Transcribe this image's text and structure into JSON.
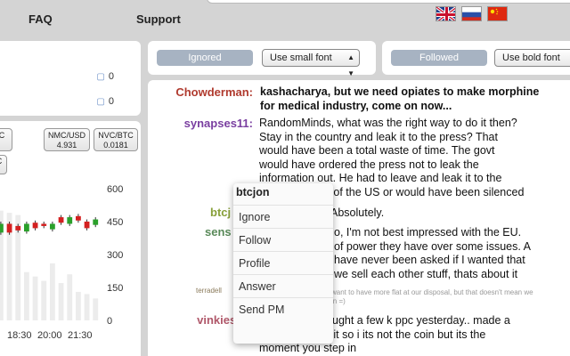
{
  "nav": {
    "faq": "FAQ",
    "support": "Support"
  },
  "languages": [
    "English",
    "Russian",
    "Chinese"
  ],
  "left_top": {
    "counts": [
      "0",
      "0"
    ]
  },
  "ticker": {
    "boxes": [
      {
        "pair": "C",
        "value": ""
      },
      {
        "pair": "NMC/USD",
        "value": "4.931"
      },
      {
        "pair": "NVC/BTC",
        "value": "0.0181"
      },
      {
        "pair": "C",
        "value": ""
      }
    ]
  },
  "chart_data": {
    "type": "candlestick",
    "x_ticks": [
      "18:30",
      "20:00",
      "21:30"
    ],
    "y_ticks": [
      "600",
      "450",
      "300",
      "150",
      "0"
    ],
    "ylim": [
      0,
      600
    ],
    "candles": [
      {
        "open": 400,
        "close": 440,
        "color": "#2aa02a"
      },
      {
        "open": 440,
        "close": 400,
        "color": "#d42020"
      },
      {
        "open": 430,
        "close": 410,
        "color": "#d42020"
      },
      {
        "open": 440,
        "close": 405,
        "color": "#2aa02a"
      },
      {
        "open": 445,
        "close": 420,
        "color": "#d42020"
      },
      {
        "open": 430,
        "close": 440,
        "color": "#d42020"
      },
      {
        "open": 440,
        "close": 415,
        "color": "#2aa02a"
      },
      {
        "open": 445,
        "close": 470,
        "color": "#d42020"
      },
      {
        "open": 470,
        "close": 440,
        "color": "#2aa02a"
      },
      {
        "open": 455,
        "close": 475,
        "color": "#d42020"
      },
      {
        "open": 450,
        "close": 420,
        "color": "#d42020"
      },
      {
        "open": 435,
        "close": 460,
        "color": "#2aa02a"
      }
    ],
    "volume": [
      500,
      490,
      480,
      220,
      200,
      180,
      260,
      170,
      210,
      130,
      120,
      100
    ]
  },
  "controls": {
    "ignored_label": "Ignored",
    "small_font_option": "Use small font",
    "followed_label": "Followed",
    "bold_font_option": "Use bold font"
  },
  "messages": [
    {
      "user": "Chowderman:",
      "color": "#b03a2e",
      "lines": [
        "kashacharya, but we need opiates to make morphine",
        "for medical industry, come on now..."
      ],
      "bold": true
    },
    {
      "user": "synapses11:",
      "color": "#7a3fa0",
      "lines": [
        "RandomMinds, what was the right way to do it then?",
        "Stay in the country and leak it to the press? That",
        "would have been a total waste of time. The govt",
        "would have ordered the press not to leak the",
        "information out. He had to leave and leak it to the",
        "de of the US or would have been silenced"
      ],
      "bold": false
    },
    {
      "user": "btcj",
      "color": "#88a03a",
      "lines": [
        "Absolutely."
      ],
      "bold": false
    },
    {
      "user": "sens",
      "color": "#5a8a5a",
      "lines": [
        "o, I'm not best impressed with the EU.",
        "of power they have over some issues. A",
        "have never been asked if I wanted that",
        "we sell each other stuff, thats about it"
      ],
      "bold": false
    },
    {
      "user": "terradell",
      "color": "#8a7a5a",
      "lines": [
        "want to have more flat at our disposal, but that doesn't mean we",
        "in =)"
      ],
      "bold": false
    },
    {
      "user": "vinkiesss:",
      "color": "#b0586a",
      "lines": [
        "doctorkesh, bought a few k ppc yesterday.. made a",
        "nice profit with it so i its not the coin but its the",
        "moment you step in"
      ],
      "bold": false
    }
  ],
  "context_menu": {
    "title": "btcjon",
    "items": [
      "Ignore",
      "Follow",
      "Profile",
      "Answer",
      "Send PM"
    ]
  }
}
